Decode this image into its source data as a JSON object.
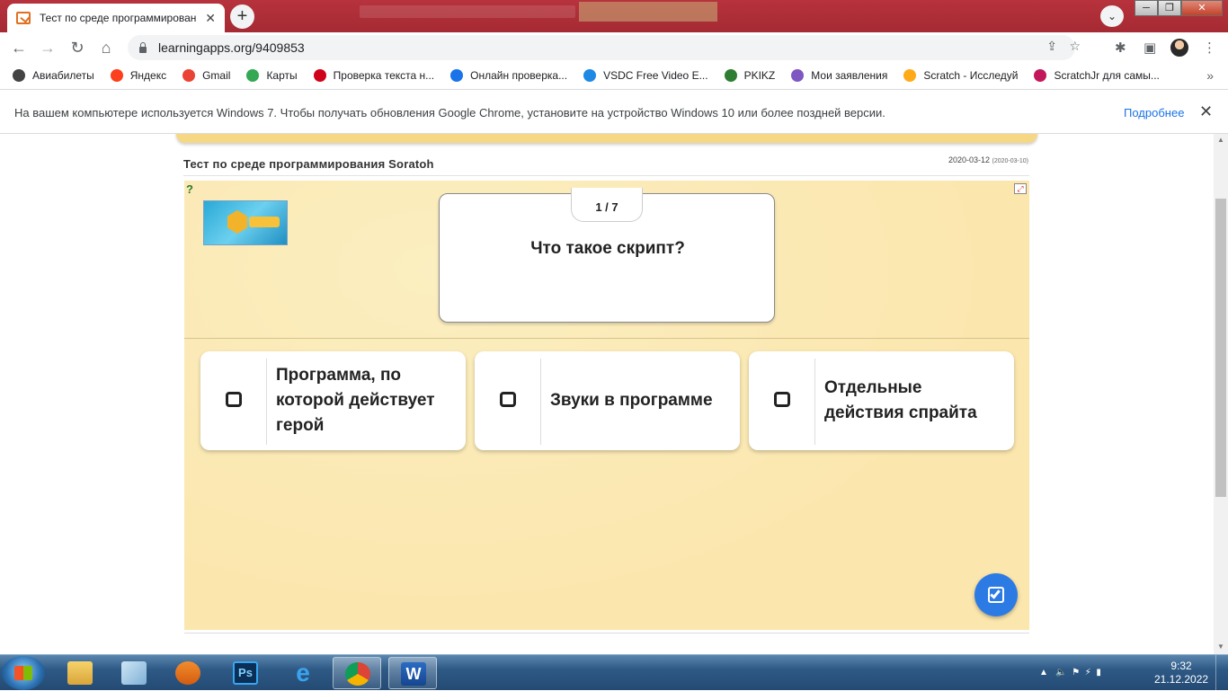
{
  "browser": {
    "tab_title": "Тест по среде программирован",
    "tab_close": "✕",
    "new_tab": "+",
    "url": "learningapps.org/9409853",
    "window_controls": [
      "─",
      "❐",
      "✕"
    ]
  },
  "bookmarks": [
    {
      "label": "Авиабилеты",
      "icon": "globe-icon",
      "color": "#444444"
    },
    {
      "label": "Яндекс",
      "icon": "yandex-icon",
      "color": "#fc3f1d"
    },
    {
      "label": "Gmail",
      "icon": "gmail-icon",
      "color": "#ea4335"
    },
    {
      "label": "Карты",
      "icon": "maps-icon",
      "color": "#34a853"
    },
    {
      "label": "Проверка текста н...",
      "icon": "copyright-icon",
      "color": "#d0021b"
    },
    {
      "label": "Онлайн проверка...",
      "icon": "ti-icon",
      "color": "#1a73e8"
    },
    {
      "label": "VSDC Free Video E...",
      "icon": "vsdc-icon",
      "color": "#1e88e5"
    },
    {
      "label": "PKIKZ",
      "icon": "pkikz-icon",
      "color": "#2e7d32"
    },
    {
      "label": "Мои заявления",
      "icon": "applications-icon",
      "color": "#7e57c2"
    },
    {
      "label": "Scratch - Исследуй",
      "icon": "scratch-icon",
      "color": "#ffab19"
    },
    {
      "label": "ScratchJr для самы...",
      "icon": "scratchjr-icon",
      "color": "#c2185b"
    }
  ],
  "infobar": {
    "message": "На вашем компьютере используется Windows 7. Чтобы получать обновления Google Chrome, установите на устройство Windows 10 или более поздней версии.",
    "link": "Подробнее",
    "close": "✕"
  },
  "app": {
    "title": "Тест по среде программирования Soratoh",
    "date": "2020-03-12",
    "date_created": "(2020-03-10)",
    "counter": "1 / 7",
    "question": "Что такое скрипт?",
    "answers": [
      "Программа, по которой действует герой",
      "Звуки в программе",
      "Отдельные действия спрайта"
    ],
    "check_icon": "check-answers-icon"
  },
  "taskbar": {
    "apps": [
      "explorer",
      "notepad",
      "media-player",
      "photoshop",
      "internet-explorer",
      "chrome",
      "word"
    ],
    "time": "9:32",
    "date": "21.12.2022"
  },
  "colors": {
    "stage_bg": "#fbe9b5",
    "accent_blue": "#2c7be5",
    "tabstrip": "#a52a33"
  }
}
